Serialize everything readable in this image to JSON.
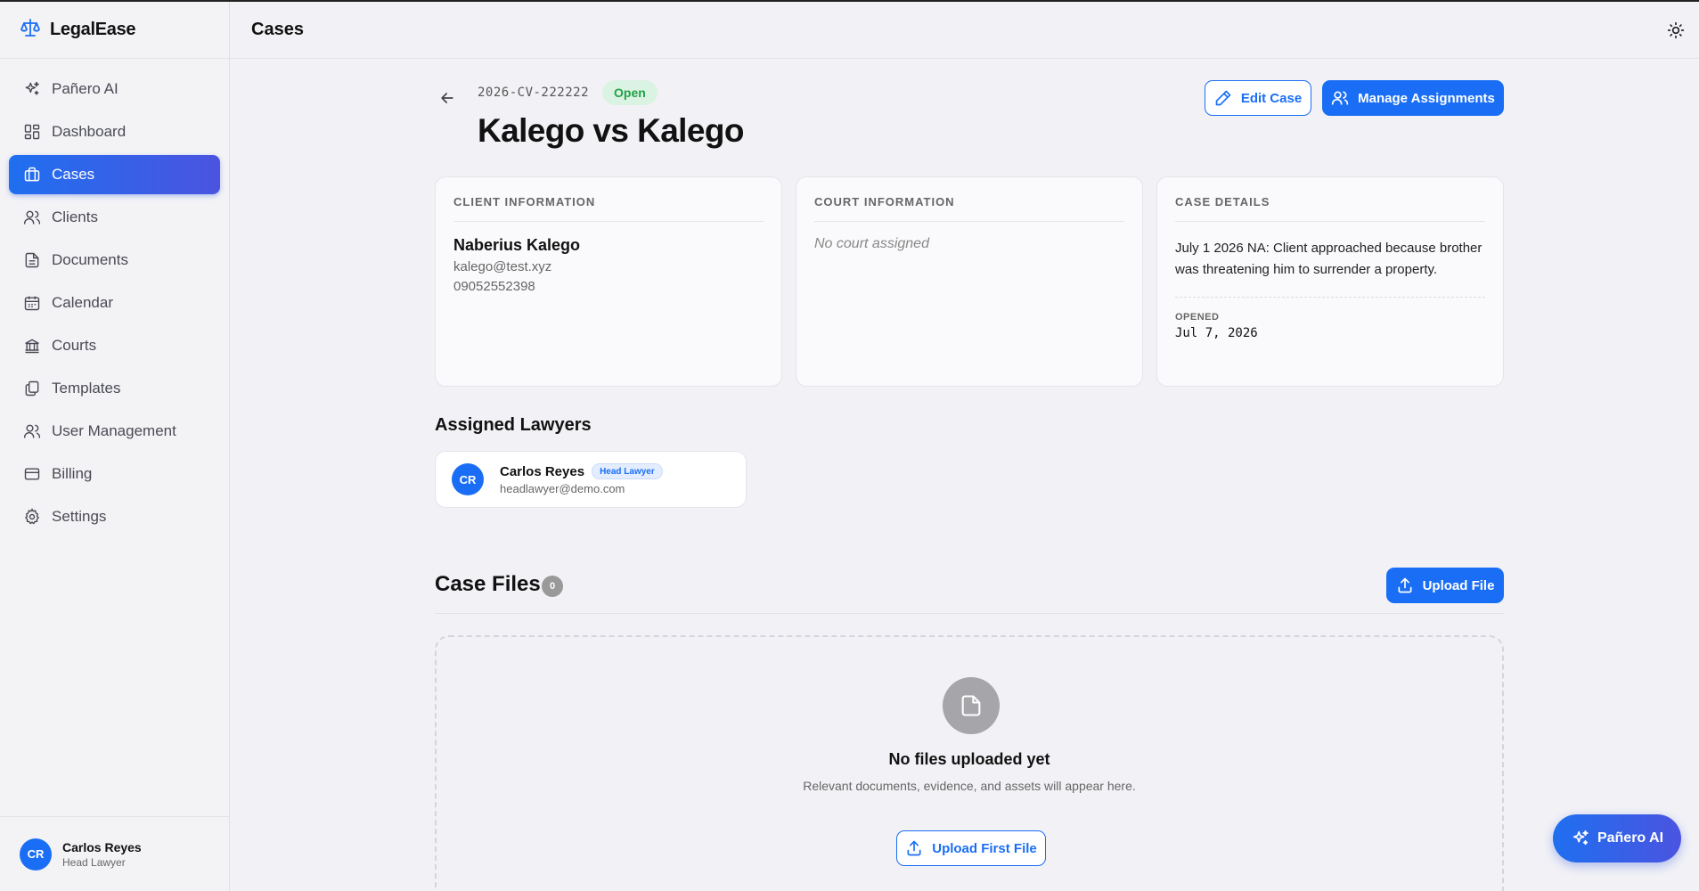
{
  "app": {
    "name": "LegalEase"
  },
  "sidebar": {
    "items": [
      {
        "label": "Pañero AI",
        "icon": "sparkles-icon"
      },
      {
        "label": "Dashboard",
        "icon": "dashboard-icon"
      },
      {
        "label": "Cases",
        "icon": "briefcase-icon"
      },
      {
        "label": "Clients",
        "icon": "users-icon"
      },
      {
        "label": "Documents",
        "icon": "document-icon"
      },
      {
        "label": "Calendar",
        "icon": "calendar-icon"
      },
      {
        "label": "Courts",
        "icon": "courthouse-icon"
      },
      {
        "label": "Templates",
        "icon": "templates-icon"
      },
      {
        "label": "User Management",
        "icon": "users-icon"
      },
      {
        "label": "Billing",
        "icon": "credit-card-icon"
      },
      {
        "label": "Settings",
        "icon": "gear-icon"
      }
    ],
    "active": "Cases",
    "user": {
      "initials": "CR",
      "name": "Carlos Reyes",
      "role": "Head Lawyer"
    }
  },
  "header": {
    "title": "Cases"
  },
  "case": {
    "number": "2026-CV-222222",
    "status": "Open",
    "title": "Kalego vs Kalego",
    "edit_label": "Edit Case",
    "manage_label": "Manage Assignments"
  },
  "client_info": {
    "heading": "CLIENT INFORMATION",
    "name": "Naberius Kalego",
    "email": "kalego@test.xyz",
    "phone": "09052552398"
  },
  "court_info": {
    "heading": "COURT INFORMATION",
    "empty": "No court assigned"
  },
  "case_details": {
    "heading": "CASE DETAILS",
    "text": "July 1 2026 NA: Client approached because brother was threatening him to surrender a property.",
    "opened_label": "OPENED",
    "opened_value": "Jul 7, 2026"
  },
  "lawyers": {
    "title": "Assigned Lawyers",
    "items": [
      {
        "initials": "CR",
        "name": "Carlos Reyes",
        "badge": "Head Lawyer",
        "email": "headlawyer@demo.com"
      }
    ]
  },
  "files": {
    "title": "Case Files",
    "count": "0",
    "upload_label": "Upload File",
    "empty_title": "No files uploaded yet",
    "empty_sub": "Relevant documents, evidence, and assets will appear here.",
    "upload_first_label": "Upload First File"
  },
  "fab": {
    "label": "Pañero AI"
  },
  "colors": {
    "accent": "#1a6ef5",
    "accent_gradient_end": "#4b54e0",
    "status_open": "#21a148"
  }
}
